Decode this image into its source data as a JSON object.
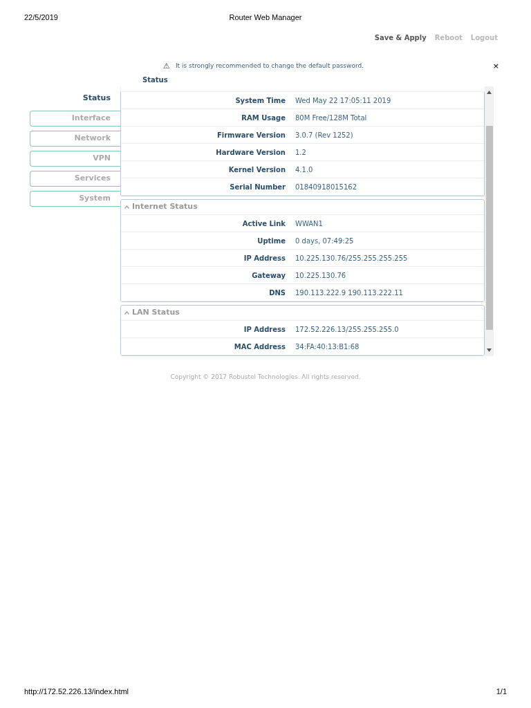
{
  "print_header": {
    "date": "22/5/2019",
    "title": "Router Web Manager"
  },
  "top_actions": [
    {
      "label": "Save & Apply",
      "disabled": false
    },
    {
      "label": "Reboot",
      "disabled": true
    },
    {
      "label": "Logout",
      "disabled": true
    }
  ],
  "alert": {
    "icon": "⚠",
    "message": "It is strongly recommended to change the default password.",
    "close": "×"
  },
  "page_title": "Status",
  "sidebar": {
    "items": [
      {
        "label": "Status",
        "selected": true
      },
      {
        "label": "Interface",
        "selected": false
      },
      {
        "label": "Network",
        "selected": false
      },
      {
        "label": "VPN",
        "selected": false
      },
      {
        "label": "Services",
        "selected": false
      },
      {
        "label": "System",
        "selected": false
      }
    ]
  },
  "sections": [
    {
      "rows": [
        {
          "label": "System Time",
          "value": "Wed May 22 17:05:11 2019"
        },
        {
          "label": "RAM Usage",
          "value": "80M Free/128M Total"
        },
        {
          "label": "Firmware Version",
          "value": "3.0.7 (Rev 1252)"
        },
        {
          "label": "Hardware Version",
          "value": "1.2"
        },
        {
          "label": "Kernel Version",
          "value": "4.1.0"
        },
        {
          "label": "Serial Number",
          "value": "01840918015162"
        }
      ]
    },
    {
      "title": "Internet Status",
      "rows": [
        {
          "label": "Active Link",
          "value": "WWAN1"
        },
        {
          "label": "Uptime",
          "value": "0 days, 07:49:25"
        },
        {
          "label": "IP Address",
          "value": "10.225.130.76/255.255.255.255"
        },
        {
          "label": "Gateway",
          "value": "10.225.130.76"
        },
        {
          "label": "DNS",
          "value": "190.113.222.9 190.113.222.11"
        }
      ]
    },
    {
      "title": "LAN Status",
      "rows": [
        {
          "label": "IP Address",
          "value": "172.52.226.13/255.255.255.0"
        },
        {
          "label": "MAC Address",
          "value": "34:FA:40:13:B1:68"
        }
      ]
    }
  ],
  "copyright": "Copyright © 2017 Robustel Technologies. All rights reserved.",
  "print_footer": {
    "url": "http://172.52.226.13/index.html",
    "page": "1/1"
  }
}
